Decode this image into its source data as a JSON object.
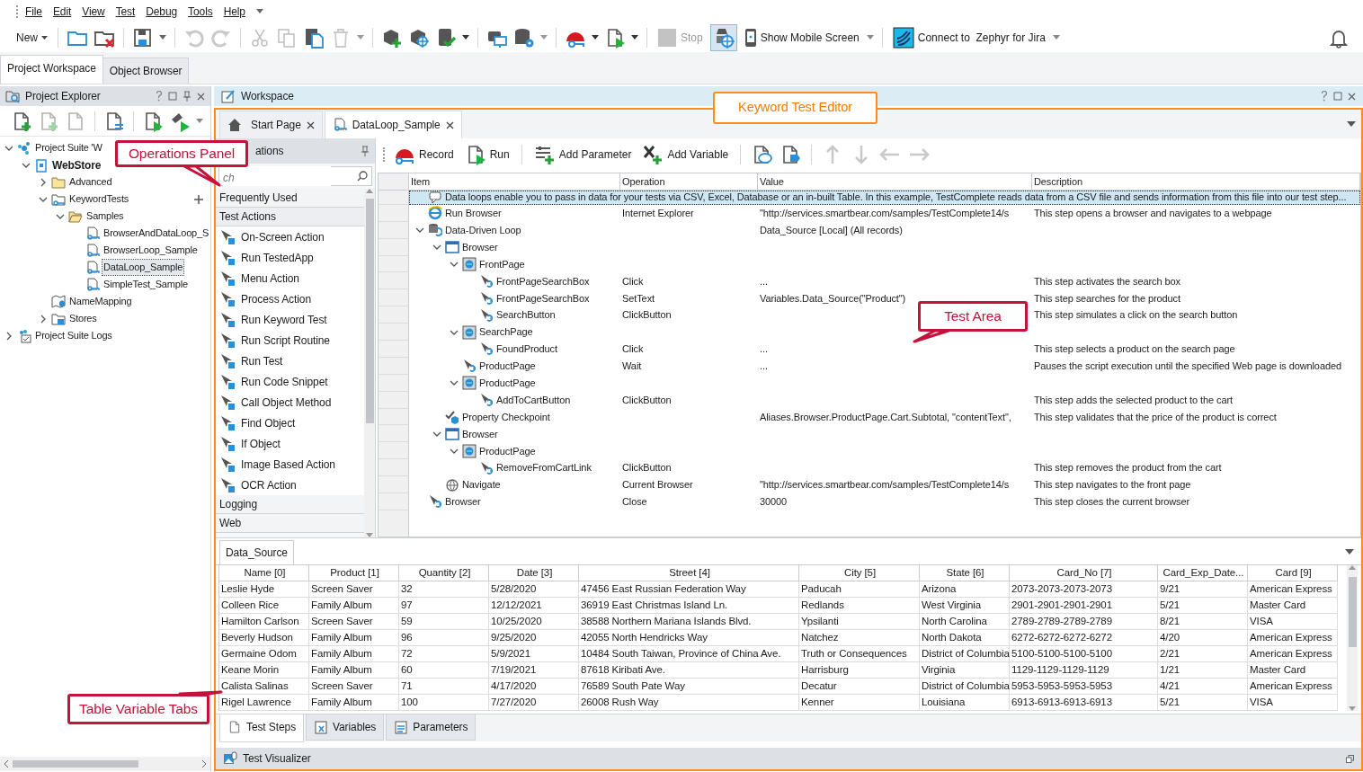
{
  "menu": [
    "File",
    "Edit",
    "View",
    "Test",
    "Debug",
    "Tools",
    "Help"
  ],
  "toolbar": {
    "new": "New",
    "stop": {
      "label": "Stop",
      "disabled": true
    },
    "mobile": "Show Mobile Screen",
    "connect": "Connect to  Zephyr for Jira"
  },
  "workspace_tabs": [
    {
      "label": "Project Workspace",
      "selected": true
    },
    {
      "label": "Object Browser",
      "selected": false
    }
  ],
  "project_explorer": {
    "title": "Project Explorer",
    "tree": [
      {
        "label": "Project Suite 'W",
        "kind": "suite",
        "expanded": true,
        "selected": false,
        "children": [
          {
            "label": "WebStore",
            "kind": "project",
            "expanded": true,
            "selected": false,
            "children": [
              {
                "label": "Advanced",
                "kind": "folder",
                "expanded": false,
                "selected": false
              },
              {
                "label": "KeywordTests",
                "kind": "keyfolder",
                "expanded": true,
                "selected": false,
                "children": [
                  {
                    "label": "Samples",
                    "kind": "openfolder",
                    "expanded": true,
                    "selected": false,
                    "children": [
                      {
                        "label": "BrowserAndDataLoop_S",
                        "kind": "test",
                        "selected": false
                      },
                      {
                        "label": "BrowserLoop_Sample",
                        "kind": "test",
                        "selected": false
                      },
                      {
                        "label": "DataLoop_Sample",
                        "kind": "test",
                        "selected": true
                      },
                      {
                        "label": "SimpleTest_Sample",
                        "kind": "test",
                        "selected": false
                      }
                    ]
                  }
                ]
              },
              {
                "label": "NameMapping",
                "kind": "mapping",
                "selected": false
              },
              {
                "label": "Stores",
                "kind": "stores",
                "expanded": false,
                "selected": false
              }
            ]
          }
        ]
      },
      {
        "label": "Project Suite Logs",
        "kind": "logs",
        "expanded": false,
        "selected": false
      }
    ]
  },
  "workspace": {
    "title": "Workspace",
    "tabs": [
      {
        "label": "Start Page",
        "kind": "home",
        "selected": false
      },
      {
        "label": "DataLoop_Sample",
        "kind": "test",
        "selected": true
      }
    ]
  },
  "operations": {
    "title": "ations",
    "search": {
      "placeholder": "ch"
    },
    "categories": [
      {
        "label": "Frequently Used"
      },
      {
        "label": "Test Actions",
        "expanded": true,
        "items": [
          "On-Screen Action",
          "Run TestedApp",
          "Menu Action",
          "Process Action",
          "Run Keyword Test",
          "Run Script Routine",
          "Run Test",
          "Run Code Snippet",
          "Call Object Method",
          "Find Object",
          "If Object",
          "Image Based Action",
          "OCR Action"
        ]
      },
      {
        "label": "Logging"
      },
      {
        "label": "Web"
      }
    ]
  },
  "test_toolbar": [
    "Record",
    "Run",
    "Add Parameter",
    "Add Variable"
  ],
  "test_steps": {
    "columns": [
      "Item",
      "Operation",
      "Value",
      "Description"
    ],
    "rows": [
      {
        "kind": "comment",
        "item": "Data loops enable you to pass in data for your tests via CSV, Excel, Database or an in-built Table. In this example, TestComplete reads data from a CSV file and sends information from this file into our test step...",
        "selected": true
      },
      {
        "kind": "browser",
        "item": "Run Browser",
        "operation": "Internet Explorer",
        "value": "\"http://services.smartbear.com/samples/TestComplete14/s",
        "description": "This step opens a browser and navigates to a webpage",
        "selected": false
      },
      {
        "kind": "loop",
        "item": "Data-Driven Loop",
        "value": "Data_Source [Local] (All records)",
        "selected": false,
        "expanded": true,
        "children": [
          {
            "kind": "window",
            "item": "Browser",
            "selected": false,
            "expanded": true,
            "children": [
              {
                "kind": "page",
                "item": "FrontPage",
                "selected": false,
                "expanded": true,
                "children": [
                  {
                    "kind": "action",
                    "item": "FrontPageSearchBox",
                    "operation": "Click",
                    "value": "...",
                    "description": "This step activates the search box",
                    "selected": false
                  },
                  {
                    "kind": "action",
                    "item": "FrontPageSearchBox",
                    "operation": "SetText",
                    "value": "Variables.Data_Source(\"Product\")",
                    "description": "This step searches for the product",
                    "selected": false
                  },
                  {
                    "kind": "action",
                    "item": "SearchButton",
                    "operation": "ClickButton",
                    "description": "This step simulates a click on the search button",
                    "selected": false
                  }
                ]
              },
              {
                "kind": "page",
                "item": "SearchPage",
                "selected": false,
                "expanded": true,
                "children": [
                  {
                    "kind": "action",
                    "item": "FoundProduct",
                    "operation": "Click",
                    "value": "...",
                    "description": "This step selects a product on the search page",
                    "selected": false
                  }
                ]
              },
              {
                "kind": "action",
                "item": "ProductPage",
                "operation": "Wait",
                "value": "...",
                "description": "Pauses the script execution until the specified Web page is downloaded",
                "selected": false
              },
              {
                "kind": "page",
                "item": "ProductPage",
                "selected": false,
                "expanded": true,
                "children": [
                  {
                    "kind": "action",
                    "item": "AddToCartButton",
                    "operation": "ClickButton",
                    "description": "This step adds the selected product to the cart",
                    "selected": false
                  }
                ]
              }
            ]
          },
          {
            "kind": "checkpoint",
            "item": "Property Checkpoint",
            "value": "Aliases.Browser.ProductPage.Cart.Subtotal, \"contentText\",",
            "description": "This step validates that the price of the product is correct",
            "selected": false
          },
          {
            "kind": "window",
            "item": "Browser",
            "selected": false,
            "expanded": true,
            "children": [
              {
                "kind": "page",
                "item": "ProductPage",
                "selected": false,
                "expanded": true,
                "children": [
                  {
                    "kind": "action",
                    "item": "RemoveFromCartLink",
                    "operation": "ClickButton",
                    "description": "This step removes the product from the cart",
                    "selected": false
                  }
                ]
              }
            ]
          },
          {
            "kind": "navigate",
            "item": "Navigate",
            "operation": "Current Browser",
            "value": "\"http://services.smartbear.com/samples/TestComplete14/s",
            "description": "This step navigates to the front page",
            "selected": false
          }
        ]
      },
      {
        "kind": "action",
        "item": "Browser",
        "operation": "Close",
        "value": "30000",
        "description": "This step closes the current browser",
        "selected": false
      }
    ]
  },
  "data_source": {
    "tab": "Data_Source",
    "columns": [
      "Name [0]",
      "Product [1]",
      "Quantity [2]",
      "Date [3]",
      "Street [4]",
      "City [5]",
      "State [6]",
      "Card_No [7]",
      "Card_Exp_Date...",
      "Card [9]"
    ],
    "rows": [
      [
        "Leslie Hyde",
        "Screen Saver",
        "32",
        "5/28/2020",
        "47456 East Russian Federation Way",
        "Paducah",
        "Arizona",
        "2073-2073-2073-2073",
        "9/21",
        "American Express"
      ],
      [
        "Colleen Rice",
        "Family Album",
        "97",
        "12/12/2021",
        "36919 East Christmas Island Ln.",
        "Redlands",
        "West Virginia",
        "2901-2901-2901-2901",
        "5/21",
        "Master Card"
      ],
      [
        "Hamilton Carlson",
        "Screen Saver",
        "59",
        "10/25/2020",
        "38588 Northern Mariana Islands Blvd.",
        "Ypsilanti",
        "North Carolina",
        "2789-2789-2789-2789",
        "8/21",
        "VISA"
      ],
      [
        "Beverly Hudson",
        "Family Album",
        "96",
        "9/25/2020",
        "42055 North Hendricks Way",
        "Natchez",
        "North Dakota",
        "6272-6272-6272-6272",
        "4/20",
        "American Express"
      ],
      [
        "Germaine Odom",
        "Family Album",
        "72",
        "5/9/2021",
        "10484 South Taiwan, Province of China Ave.",
        "Truth or Consequences",
        "District of Columbia",
        "5100-5100-5100-5100",
        "2/21",
        "American Express"
      ],
      [
        "Keane Morin",
        "Family Album",
        "60",
        "7/19/2021",
        "87618 Kiribati Ave.",
        "Harrisburg",
        "Virginia",
        "1129-1129-1129-1129",
        "1/21",
        "Master Card"
      ],
      [
        "Calista Salinas",
        "Screen Saver",
        "71",
        "4/17/2020",
        "76589 South Pate Way",
        "Decatur",
        "District of Columbia",
        "5953-5953-5953-5953",
        "4/21",
        "American Express"
      ],
      [
        "Rigel Lawrence",
        "Family Album",
        "100",
        "7/27/2020",
        "26008 Rush Way",
        "Kenner",
        "Louisiana",
        "6913-6913-6913-6913",
        "5/21",
        "VISA"
      ]
    ]
  },
  "bottom_tabs": [
    {
      "label": "Test Steps",
      "selected": true
    },
    {
      "label": "Variables",
      "selected": false
    },
    {
      "label": "Parameters",
      "selected": false
    }
  ],
  "visualizer": "Test Visualizer",
  "callouts": [
    {
      "text": "Operations Panel",
      "kind": "annotation"
    },
    {
      "text": "Keyword Test Editor",
      "kind": "frame"
    },
    {
      "text": "Test Area",
      "kind": "annotation"
    },
    {
      "text": "Table Variable Tabs",
      "kind": "annotation"
    }
  ]
}
